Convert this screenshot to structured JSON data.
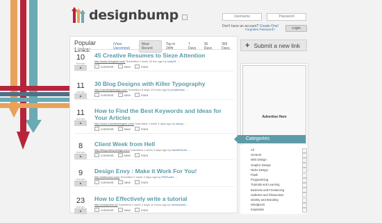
{
  "colors": {
    "accent": "#5a9aa8",
    "ribbon_red": "#b7243a",
    "ribbon_orange": "#e8a25a",
    "ribbon_teal": "#6aaab3",
    "ribbon_slate": "#4f6f8a"
  },
  "brand": {
    "name": "designbump"
  },
  "login": {
    "username_placeholder": "Username",
    "password_placeholder": "Password",
    "no_account": "Don't have an account?",
    "create_one": "Create One!",
    "forgot": "Forgotten Password?",
    "login_label": "Login"
  },
  "links": {
    "heading": "Popular Links:",
    "view_upcoming": "(View Upcoming)",
    "tabs": [
      "Most Recent",
      "Top in 24Hr",
      "7 Days",
      "30 Days",
      "365 Days"
    ],
    "action_labels": {
      "comment": "comment",
      "save": "save",
      "more": "more"
    },
    "vote_label": "bumps",
    "bump_symbol": "▲",
    "items": [
      {
        "votes": "10",
        "title": "45 Creative Resumes to Sieze Attention",
        "url": "http://www.hongkiat.com/",
        "meta": " Submitted 1 week 32 min ago by ",
        "author": "rusty31",
        "suffix": " →"
      },
      {
        "votes": "11",
        "title": "30 Blog Designs with Killer Typography",
        "url": "http://vandelaydesign.com/",
        "meta": " Submitted 6 days 22 hours ago by ",
        "author": "jonathfhlps",
        "suffix": " →"
      },
      {
        "votes": "11",
        "title": "How to Find the Best Keywords and Ideas for Your Articles",
        "url": "http://www.1stwebdesigner.com/",
        "meta": " Submitted 1 week 3 days ago by ",
        "author": "danny",
        "suffix": " →"
      },
      {
        "votes": "8",
        "title": "Client Week from Hell",
        "url": "http://blog.xbery.design.com/",
        "meta": " Submitted 1 week 3 days ago by ",
        "author": "DavidPerrett",
        "suffix": " →"
      },
      {
        "votes": "9",
        "title": "Design Envy : Make it Work For You!",
        "url": "http://webvoice.com/",
        "meta": " Submitted 1 week 3 days ago by ",
        "author": "PetPuzzle",
        "suffix": " →"
      },
      {
        "votes": "23",
        "title": "How to Effectively write a tutorial",
        "url": "http://nobavorks.tv/",
        "meta": " Submitted 1 week 2 days 12 hours ago by ",
        "author": "nicholouster",
        "suffix": " →"
      }
    ]
  },
  "sidebar": {
    "submit_label": "Submit a new link",
    "ad_label": "Advertise Here",
    "categories_heading": "Categories",
    "categories": [
      "All",
      "General",
      "Web Design",
      "Graphic Design",
      "Niche Design",
      "Flash",
      "Programming",
      "Tutorials and Learning",
      "Business and Freelancing",
      "Galleries and Showcases",
      "Identity and Branding",
      "Wordpress",
      "Inspiration"
    ]
  }
}
